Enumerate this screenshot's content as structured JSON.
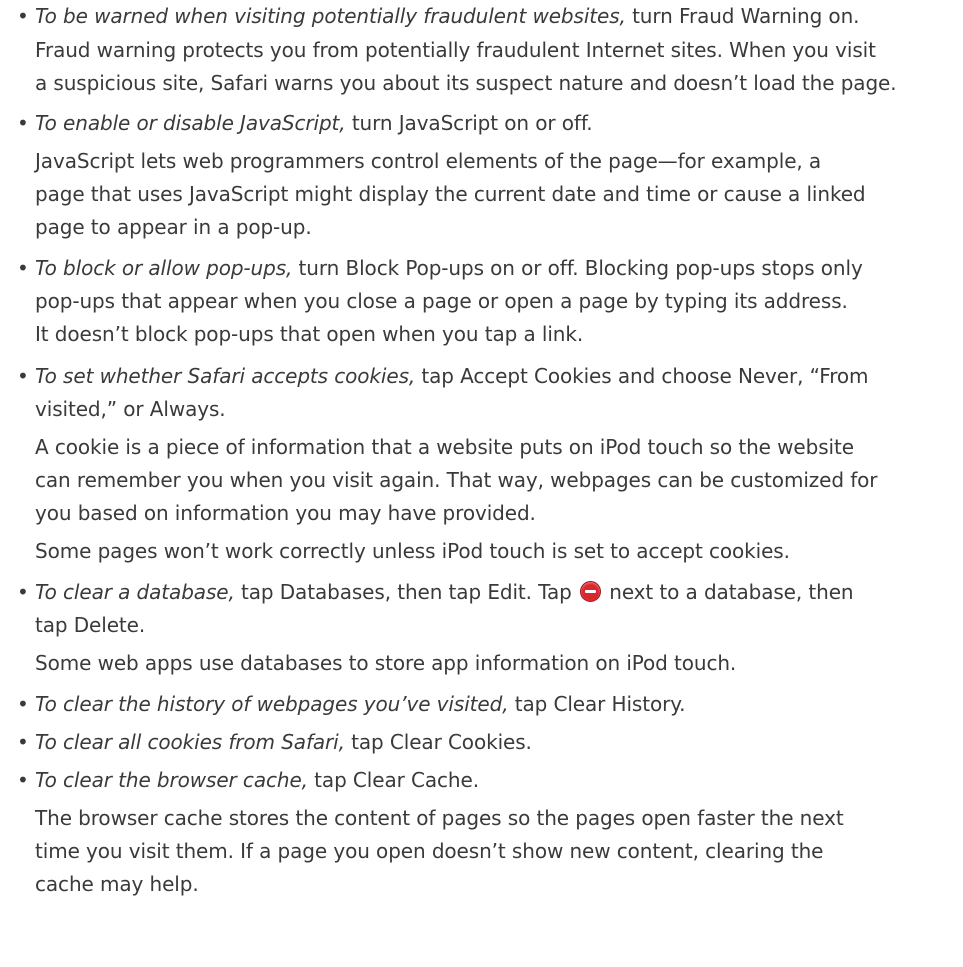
{
  "items": [
    {
      "lead": "To be warned when visiting potentially fraudulent websites,",
      "rest": " turn Fraud Warning on."
    },
    {
      "lead": "To enable or disable JavaScript,",
      "rest": " turn JavaScript on or off."
    },
    {
      "lead": "To block or allow pop-ups,",
      "rest1": " turn Block Pop-ups on or off. Blocking pop-ups stops only",
      "rest2": "pop-ups that appear when you close a page or open a page by typing its address.",
      "rest3": "It doesn’t block pop-ups that open when you tap a link."
    },
    {
      "lead": "To set whether Safari accepts cookies,",
      "rest1": " tap Accept Cookies and choose Never, “From",
      "rest2": "visited,” or Always."
    },
    {
      "lead": "To clear a database,",
      "rest1a": " tap Databases, then tap Edit. Tap ",
      "rest1b": " next to a database, then",
      "rest2": "tap Delete."
    },
    {
      "lead": "To clear the history of webpages you’ve visited,",
      "rest": " tap Clear History."
    },
    {
      "lead": "To clear all cookies from Safari,",
      "rest": " tap Clear Cookies."
    },
    {
      "lead": "To clear the browser cache,",
      "rest": " tap Clear Cache."
    }
  ],
  "paragraphs": {
    "fraud": [
      "Fraud warning protects you from potentially fraudulent Internet sites. When you visit",
      "a suspicious site, Safari warns you about its suspect nature and doesn’t load the page."
    ],
    "javascript": [
      "JavaScript lets web programmers control elements of the page—for example, a",
      "page that uses JavaScript might display the current date and time or cause a linked",
      "page to appear in a pop-up."
    ],
    "cookie": [
      "A cookie is a piece of information that a website puts on iPod touch so the website",
      "can remember you when you visit again. That way, webpages can be customized for",
      "you based on information you may have provided."
    ],
    "cookie_note": "Some pages won’t work correctly unless iPod touch is set to accept cookies.",
    "database_note": "Some web apps use databases to store app information on iPod touch.",
    "cache": [
      "The browser cache stores the content of pages so the pages open faster the next",
      "time you visit them. If a page you open doesn’t show new content, clearing the",
      "cache may help."
    ]
  },
  "bullet_glyph": "•",
  "icons": {
    "delete": "delete-circle-icon"
  },
  "colors": {
    "text": "#3a3a3a",
    "delete_icon": "#d9262f"
  }
}
